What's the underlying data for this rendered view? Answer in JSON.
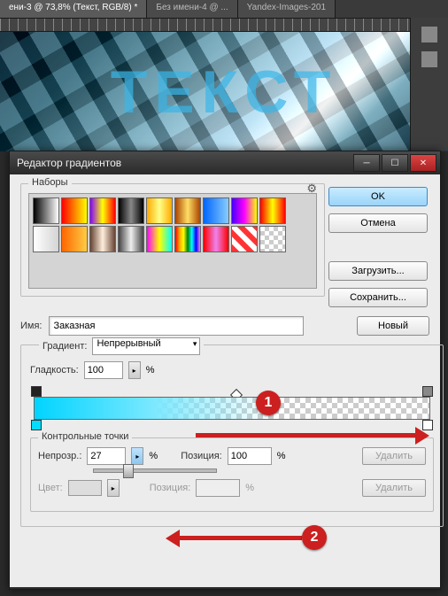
{
  "tabs": [
    "ени-3 @ 73,8% (Текст, RGB/8) *",
    "Без имени-4 @ ...",
    "Yandex-Images-201"
  ],
  "canvas_text": "ТЕКСТ",
  "dialog": {
    "title": "Редактор градиентов"
  },
  "buttons": {
    "ok": "OK",
    "cancel": "Отмена",
    "load": "Загрузить...",
    "save": "Сохранить...",
    "new": "Новый",
    "delete": "Удалить"
  },
  "labels": {
    "presets": "Наборы",
    "name": "Имя:",
    "grad_type": "Градиент:",
    "smoothness": "Гладкость:",
    "stops": "Контрольные точки",
    "opacity": "Непрозр.:",
    "position": "Позиция:",
    "color": "Цвет:",
    "percent": "%"
  },
  "values": {
    "name": "Заказная",
    "grad_type": "Непрерывный",
    "smoothness": "100",
    "opacity": "27",
    "position_op": "100",
    "position_cl": ""
  },
  "annot": {
    "b1": "1",
    "b2": "2"
  },
  "swatches": [
    "linear-gradient(90deg,#000,#fff)",
    "linear-gradient(90deg,red,yellow)",
    "linear-gradient(90deg,#80f,#ff0,#f00)",
    "linear-gradient(90deg,#000,#888,#000)",
    "linear-gradient(90deg,#fa0,#ff8,#fa0)",
    "linear-gradient(90deg,#a40,#fd6,#a40)",
    "linear-gradient(90deg,#06f,#8cf)",
    "linear-gradient(90deg,#40f,#f0f,#ff0)",
    "linear-gradient(90deg,red,yellow,red)",
    "linear-gradient(90deg,#fff,transparent)",
    "linear-gradient(90deg,#f60,#fc4)",
    "linear-gradient(90deg,#643,#fed,#643)",
    "linear-gradient(90deg,#444,#eee,#444)",
    "linear-gradient(90deg,#f0f,#ff0,#0ff)",
    "linear-gradient(90deg,red,orange,yellow,green,cyan,blue,violet)",
    "linear-gradient(90deg,red,violet,red)",
    "repeating-linear-gradient(45deg,#f33 0 6px,#fff 6px 12px)",
    "repeating-conic-gradient(#ccc 0 25%,#fff 0 50%) 0 0/10px 10px"
  ]
}
